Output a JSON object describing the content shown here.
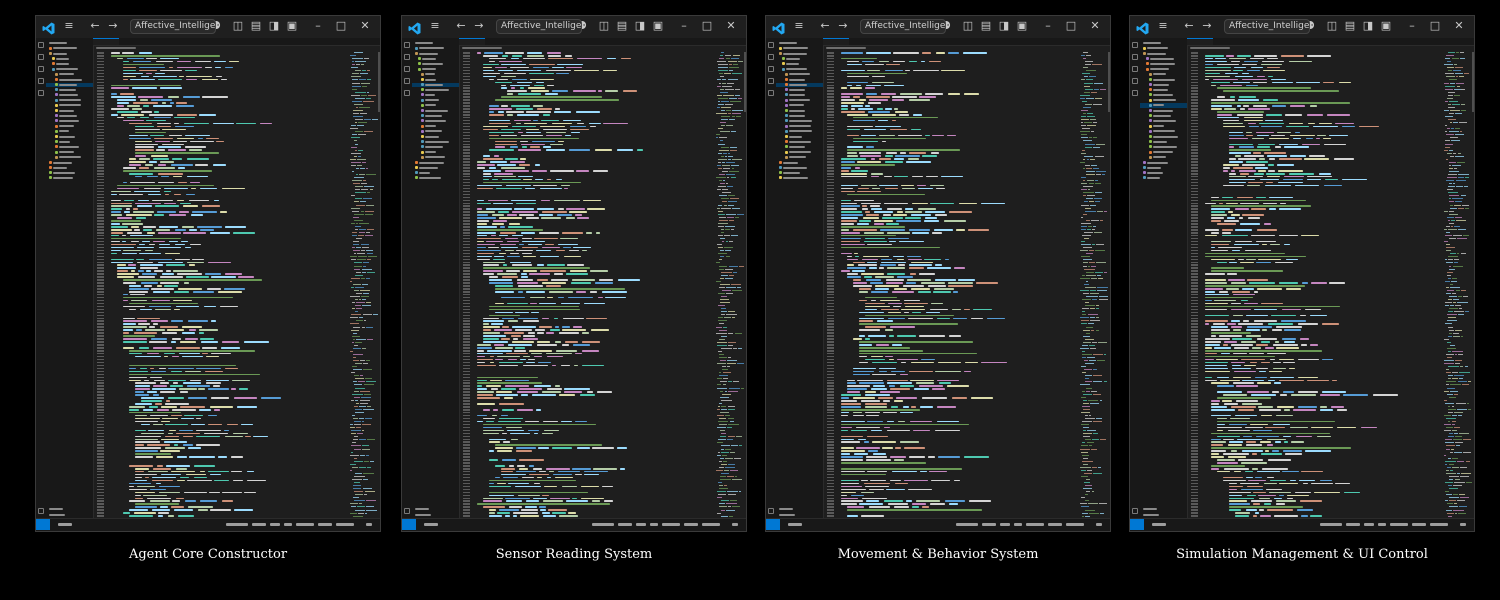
{
  "window": {
    "search_text": "Affective_Intelligenc",
    "icons": [
      "vscode-logo",
      "menu-icon",
      "back-arrow-icon",
      "forward-arrow-icon",
      "toggle-sidebar-icon",
      "toggle-panel-icon",
      "toggle-secondary-sidebar-icon",
      "customize-layout-icon",
      "copilot-icon",
      "minimize-icon",
      "maximize-icon",
      "close-icon"
    ]
  },
  "colors": {
    "background": "#000000",
    "editor": "#1e1e1e",
    "sidebar": "#181818",
    "accent": "#0078d4",
    "keyword": "#c586c0",
    "keyword_blue": "#569cd6",
    "variable": "#9cdcfe",
    "function": "#dcdcaa",
    "string": "#ce9178",
    "number": "#b5cea8",
    "comment": "#6a9955",
    "type": "#4ec9b0",
    "plain": "#d4d4d4"
  },
  "panels": [
    {
      "caption": "Agent Core Constructor",
      "selected_file": 7,
      "seed": 11
    },
    {
      "caption": "Sensor Reading System",
      "selected_file": 7,
      "seed": 29
    },
    {
      "caption": "Movement & Behavior System",
      "selected_file": 7,
      "seed": 47
    },
    {
      "caption": "Simulation Management & UI Control",
      "selected_file": 11,
      "seed": 73
    }
  ]
}
